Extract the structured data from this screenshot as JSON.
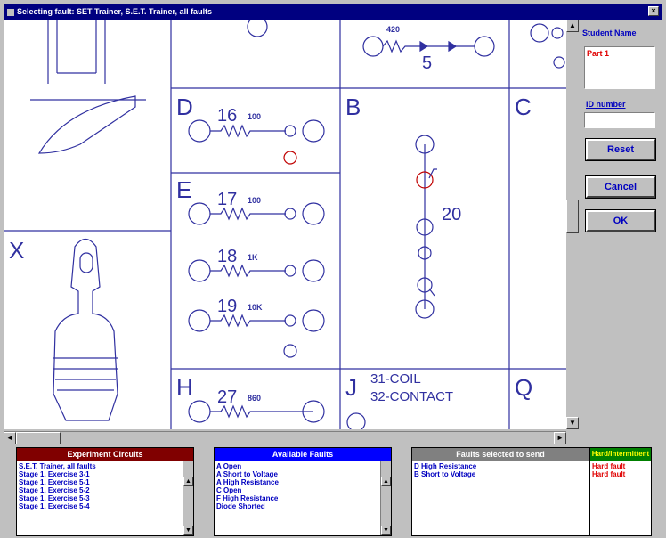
{
  "window": {
    "title": "Selecting fault: SET Trainer, S.E.T. Trainer, all faults",
    "close_label": "×"
  },
  "diagram": {
    "sections": {
      "D": "D",
      "B": "B",
      "C": "C",
      "E": "E",
      "X": "X",
      "H": "H",
      "J": "J",
      "Q": "Q"
    },
    "labels": {
      "n5": "5",
      "r5": "420",
      "n16": "16",
      "r16": "100",
      "n17": "17",
      "r17": "100",
      "n18": "18",
      "r18": "1K",
      "n19": "19",
      "r19": "10K",
      "n20": "20",
      "n27": "27",
      "r27": "860",
      "coil": "31-COIL",
      "contact": "32-CONTACT"
    }
  },
  "right_panel": {
    "student_name_label": "Student Name",
    "student_name_value": "Part 1",
    "id_label": "ID number",
    "id_value": "",
    "reset_label": "Reset",
    "cancel_label": "Cancel",
    "ok_label": "OK"
  },
  "experiment_circuits": {
    "header": "Experiment Circuits",
    "items": [
      "S.E.T. Trainer, all faults",
      "Stage 1, Exercise 3-1",
      "Stage 1, Exercise 5-1",
      "Stage 1, Exercise 5-2",
      "Stage 1, Exercise 5-3",
      "Stage 1, Exercise 5-4"
    ]
  },
  "available_faults": {
    "header": "Available Faults",
    "items": [
      "A Open",
      "A Short to Voltage",
      "A High Resistance",
      "C Open",
      "F High Resistance",
      "Diode Shorted"
    ]
  },
  "selected_faults": {
    "header": "Faults selected to send",
    "items": [
      "D High Resistance",
      "B Short to Voltage"
    ],
    "type_header": "Hard/Intermittent",
    "types": [
      "Hard fault",
      "Hard fault"
    ]
  },
  "colors": {
    "titlebar": "#000080",
    "blue": "#0000c0",
    "red": "#e00000",
    "exp_header": "#800000",
    "avail_header": "#0000ff",
    "sel_header": "#808080",
    "type_header": "#008000"
  }
}
